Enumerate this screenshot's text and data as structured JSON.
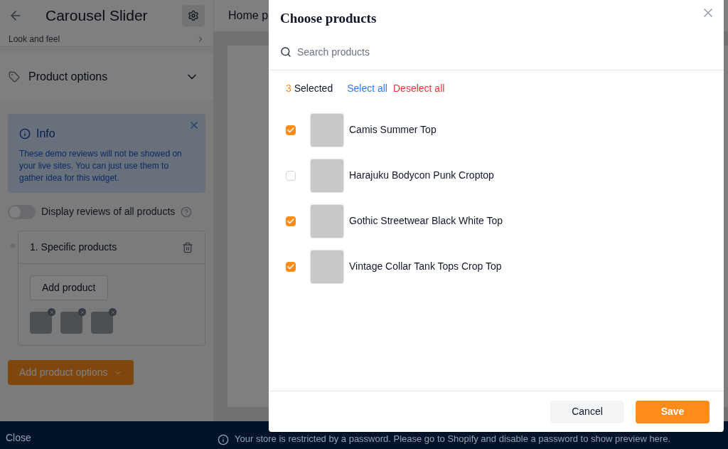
{
  "editor": {
    "title": "Carousel Slider",
    "collapsed_section": {
      "label": "Look and feel"
    },
    "section": {
      "label": "Product options",
      "expanded": true
    },
    "info": {
      "title": "Info",
      "text": "These demo reviews will not be showed on your live sites. You can just use them to gather idea for this widget."
    },
    "toggle": {
      "label": "Display reviews of all products",
      "on": false
    },
    "option": {
      "title": "1. Specific products",
      "button": "Add product"
    },
    "add_button": "Add product options"
  },
  "preview": {
    "tab": "Home p"
  },
  "status_bar": {
    "close": "Close",
    "message": "Your store is restricted by a password. Please go to Shopify and disable a password to show preview here."
  },
  "dialog": {
    "title": "Choose products",
    "search": {
      "placeholder": "Search products"
    },
    "selected_count": "3",
    "selected_label": "Selected",
    "select_all": "Select all",
    "deselect_all": "Deselect all",
    "products": [
      {
        "name": "Camis Summer Top",
        "checked": true
      },
      {
        "name": "Harajuku Bodycon Punk Croptop",
        "checked": false
      },
      {
        "name": "Gothic Streetwear Black White Top",
        "checked": true
      },
      {
        "name": "Vintage Collar Tank Tops Crop Top",
        "checked": true
      }
    ],
    "buttons": {
      "cancel": "Cancel",
      "save": "Save"
    }
  }
}
